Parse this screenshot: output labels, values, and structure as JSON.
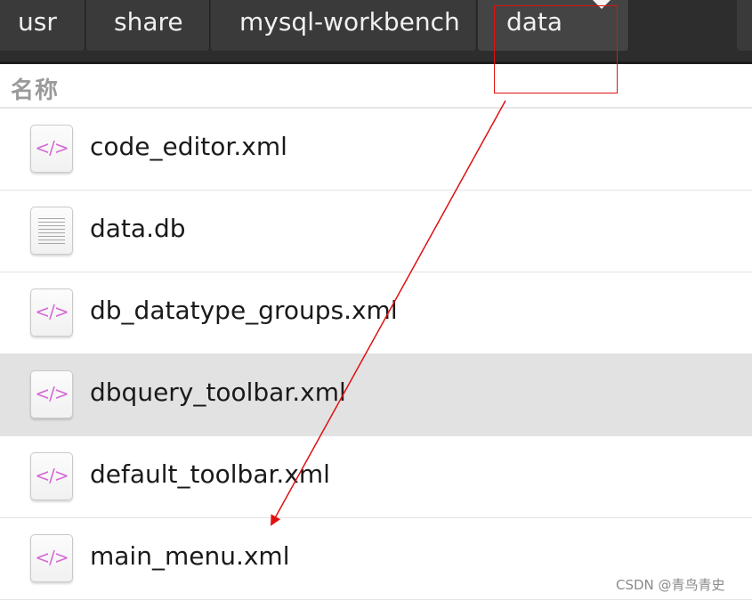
{
  "pathbar": {
    "crumbs": [
      "usr",
      "share",
      "mysql-workbench",
      "data"
    ],
    "active_crumb_icon": "dropdown-triangle-icon"
  },
  "list": {
    "column_header": "名称",
    "files": [
      {
        "name": "code_editor.xml",
        "icon": "xml-file-icon",
        "selected": false
      },
      {
        "name": "data.db",
        "icon": "text-file-icon",
        "selected": false
      },
      {
        "name": "db_datatype_groups.xml",
        "icon": "xml-file-icon",
        "selected": false
      },
      {
        "name": "dbquery_toolbar.xml",
        "icon": "xml-file-icon",
        "selected": true
      },
      {
        "name": "default_toolbar.xml",
        "icon": "xml-file-icon",
        "selected": false
      },
      {
        "name": "main_menu.xml",
        "icon": "xml-file-icon",
        "selected": false
      }
    ]
  },
  "colors": {
    "pathbar_bg": "#2d2d2d",
    "selected_row": "#e2e2e2",
    "annotation_red": "#e01010",
    "xml_icon_glyph": "#d66ad6"
  },
  "watermark": "CSDN @青鸟青史"
}
